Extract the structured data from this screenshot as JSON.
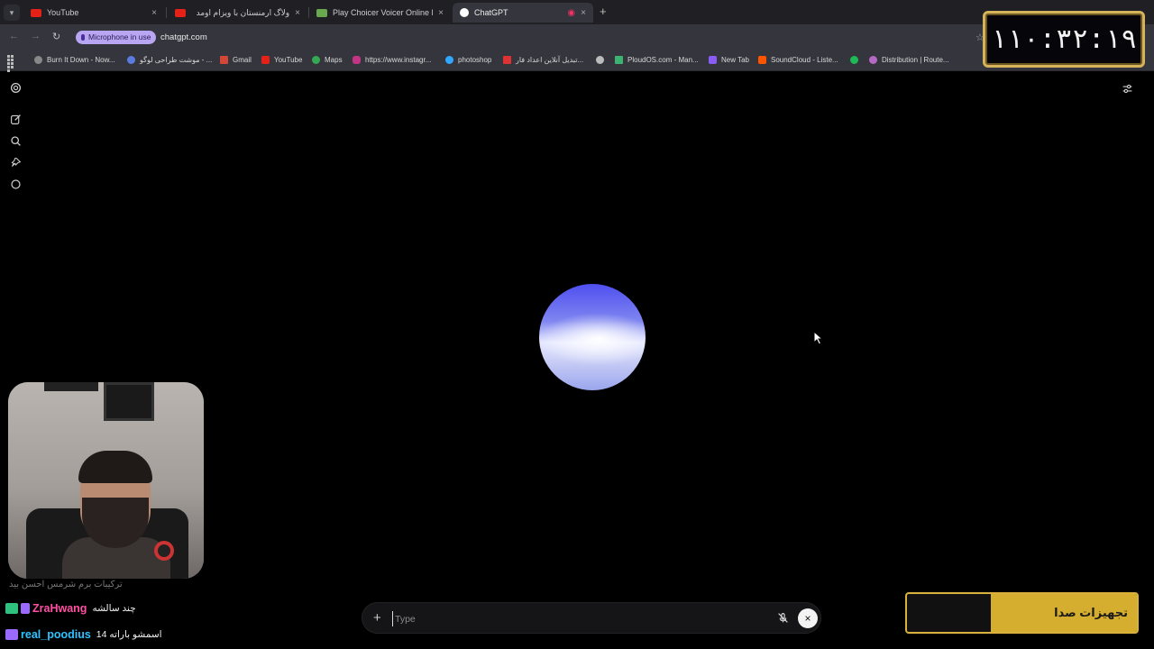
{
  "tabs": [
    {
      "title": "YouTube",
      "favicon_color": "#e62117"
    },
    {
      "title": "ولاگ ارمنستان با ویزام اومد",
      "favicon_color": "#e62117"
    },
    {
      "title": "Play Choicer Voicer Online Free",
      "favicon_color": "#6aa84f"
    },
    {
      "title": "ChatGPT",
      "favicon_color": "#ffffff",
      "active": true
    }
  ],
  "tab_close_glyph": "×",
  "tab_recording_glyph": "◉",
  "new_tab_glyph": "+",
  "address": {
    "mic_chip": "Microphone in use",
    "url": "chatgpt.com"
  },
  "bookmarks": [
    {
      "label": "Burn It Down - Now...",
      "icon_color": "#888"
    },
    {
      "label": "موشت طراحی لوگو - ...",
      "icon_color": "#5a7ce0"
    },
    {
      "label": "Gmail",
      "icon_color": "#d44638"
    },
    {
      "label": "YouTube",
      "icon_color": "#e62117"
    },
    {
      "label": "Maps",
      "icon_color": "#34a853"
    },
    {
      "label": "https://www.instagr...",
      "icon_color": "#c13584"
    },
    {
      "label": "photoshop",
      "icon_color": "#31a8ff"
    },
    {
      "label": "تبدیل آنلاین اعداد فار...",
      "icon_color": "#d33"
    },
    {
      "label": "",
      "icon_color": "#bbb"
    },
    {
      "label": "PloudOS.com - Man...",
      "icon_color": "#3cb371"
    },
    {
      "label": "New Tab",
      "icon_color": "#8a5cf6"
    },
    {
      "label": "SoundCloud - Liste...",
      "icon_color": "#ff5500"
    },
    {
      "label": "",
      "icon_color": "#1db954"
    },
    {
      "label": "Distribution | Route...",
      "icon_color": "#b569c4"
    }
  ],
  "clock": "۱۱۰:۳۲:۱۹",
  "composer": {
    "plus_glyph": "+",
    "placeholder": "Type",
    "close_glyph": "×"
  },
  "chat": [
    {
      "user": "ZraHwang",
      "message": "چند سالشه",
      "user_color": "#ff4fa3"
    },
    {
      "user": "real_poodius",
      "message": "اسمشو باراته 14",
      "user_color": "#2ec4ff"
    }
  ],
  "chat_faded": "ترکیبات برم شرمس احسن بید",
  "overlay_label": "تجهیزات صدا",
  "colors": {
    "accent_gold": "#d6ae2f",
    "mic_chip": "#b9a6f2"
  }
}
